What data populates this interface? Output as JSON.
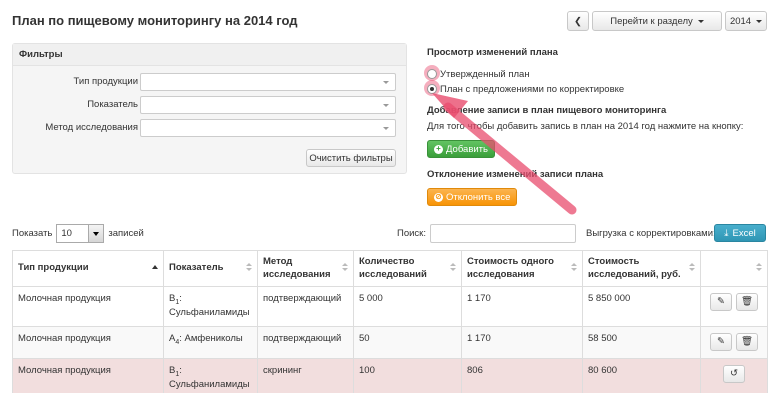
{
  "page": {
    "title": "План по пищевому мониторингу на 2014 год"
  },
  "top_controls": {
    "back_icon": "chevron-left-icon",
    "section_button_label": "Перейти к разделу",
    "year_value": "2014"
  },
  "filters": {
    "title": "Фильтры",
    "fields": [
      {
        "label": "Тип продукции",
        "value": ""
      },
      {
        "label": "Показатель",
        "value": ""
      },
      {
        "label": "Метод исследования",
        "value": ""
      }
    ],
    "clear_label": "Очистить фильтры"
  },
  "plan_view": {
    "title": "Просмотр изменений плана",
    "options": [
      {
        "label": "Утвержденный план",
        "checked": false
      },
      {
        "label": "План с предложениями по корректировке",
        "checked": true
      }
    ]
  },
  "add_record": {
    "title": "Добавление записи в план пищевого мониторинга",
    "description": "Для того чтобы добавить запись в план на 2014 год нажмите на кнопку:",
    "button_label": "Добавить"
  },
  "reject_changes": {
    "title": "Отклонение изменений записи плана",
    "button_label": "Отклонить все"
  },
  "table_controls": {
    "show_prefix": "Показать",
    "page_length": "10",
    "show_suffix": "записей",
    "search_label": "Поиск:",
    "search_value": "",
    "export_label": "Выгрузка с корректировками:",
    "excel_label": "Excel"
  },
  "table": {
    "headers": [
      "Тип продукции",
      "Показатель",
      "Метод исследования",
      "Количество исследований",
      "Стоимость одного исследования",
      "Стоимость исследований, руб.",
      ""
    ],
    "rows": [
      {
        "product": "Молочная продукция",
        "indicator_code": "B",
        "indicator_sub": "1",
        "indicator_name": ": Сульфаниламиды",
        "method": "подтверждающий",
        "count": "5 000",
        "unit_cost": "1 170",
        "total": "5 850 000",
        "state": "normal"
      },
      {
        "product": "Молочная продукция",
        "indicator_code": "A",
        "indicator_sub": "4",
        "indicator_name": ": Амфениколы",
        "method": "подтверждающий",
        "count": "50",
        "unit_cost": "1 170",
        "total": "58 500",
        "state": "normal"
      },
      {
        "product": "Молочная продукция",
        "indicator_code": "B",
        "indicator_sub": "1",
        "indicator_name": ": Сульфаниламиды",
        "method": "скрининг",
        "count": "100",
        "unit_cost": "806",
        "total": "80 600",
        "state": "rejected"
      }
    ]
  },
  "colors": {
    "highlight": "#e84c6e",
    "success": "#5bb75b",
    "warning": "#f89406",
    "info": "#2f96b4",
    "error_row": "#f2dede"
  }
}
